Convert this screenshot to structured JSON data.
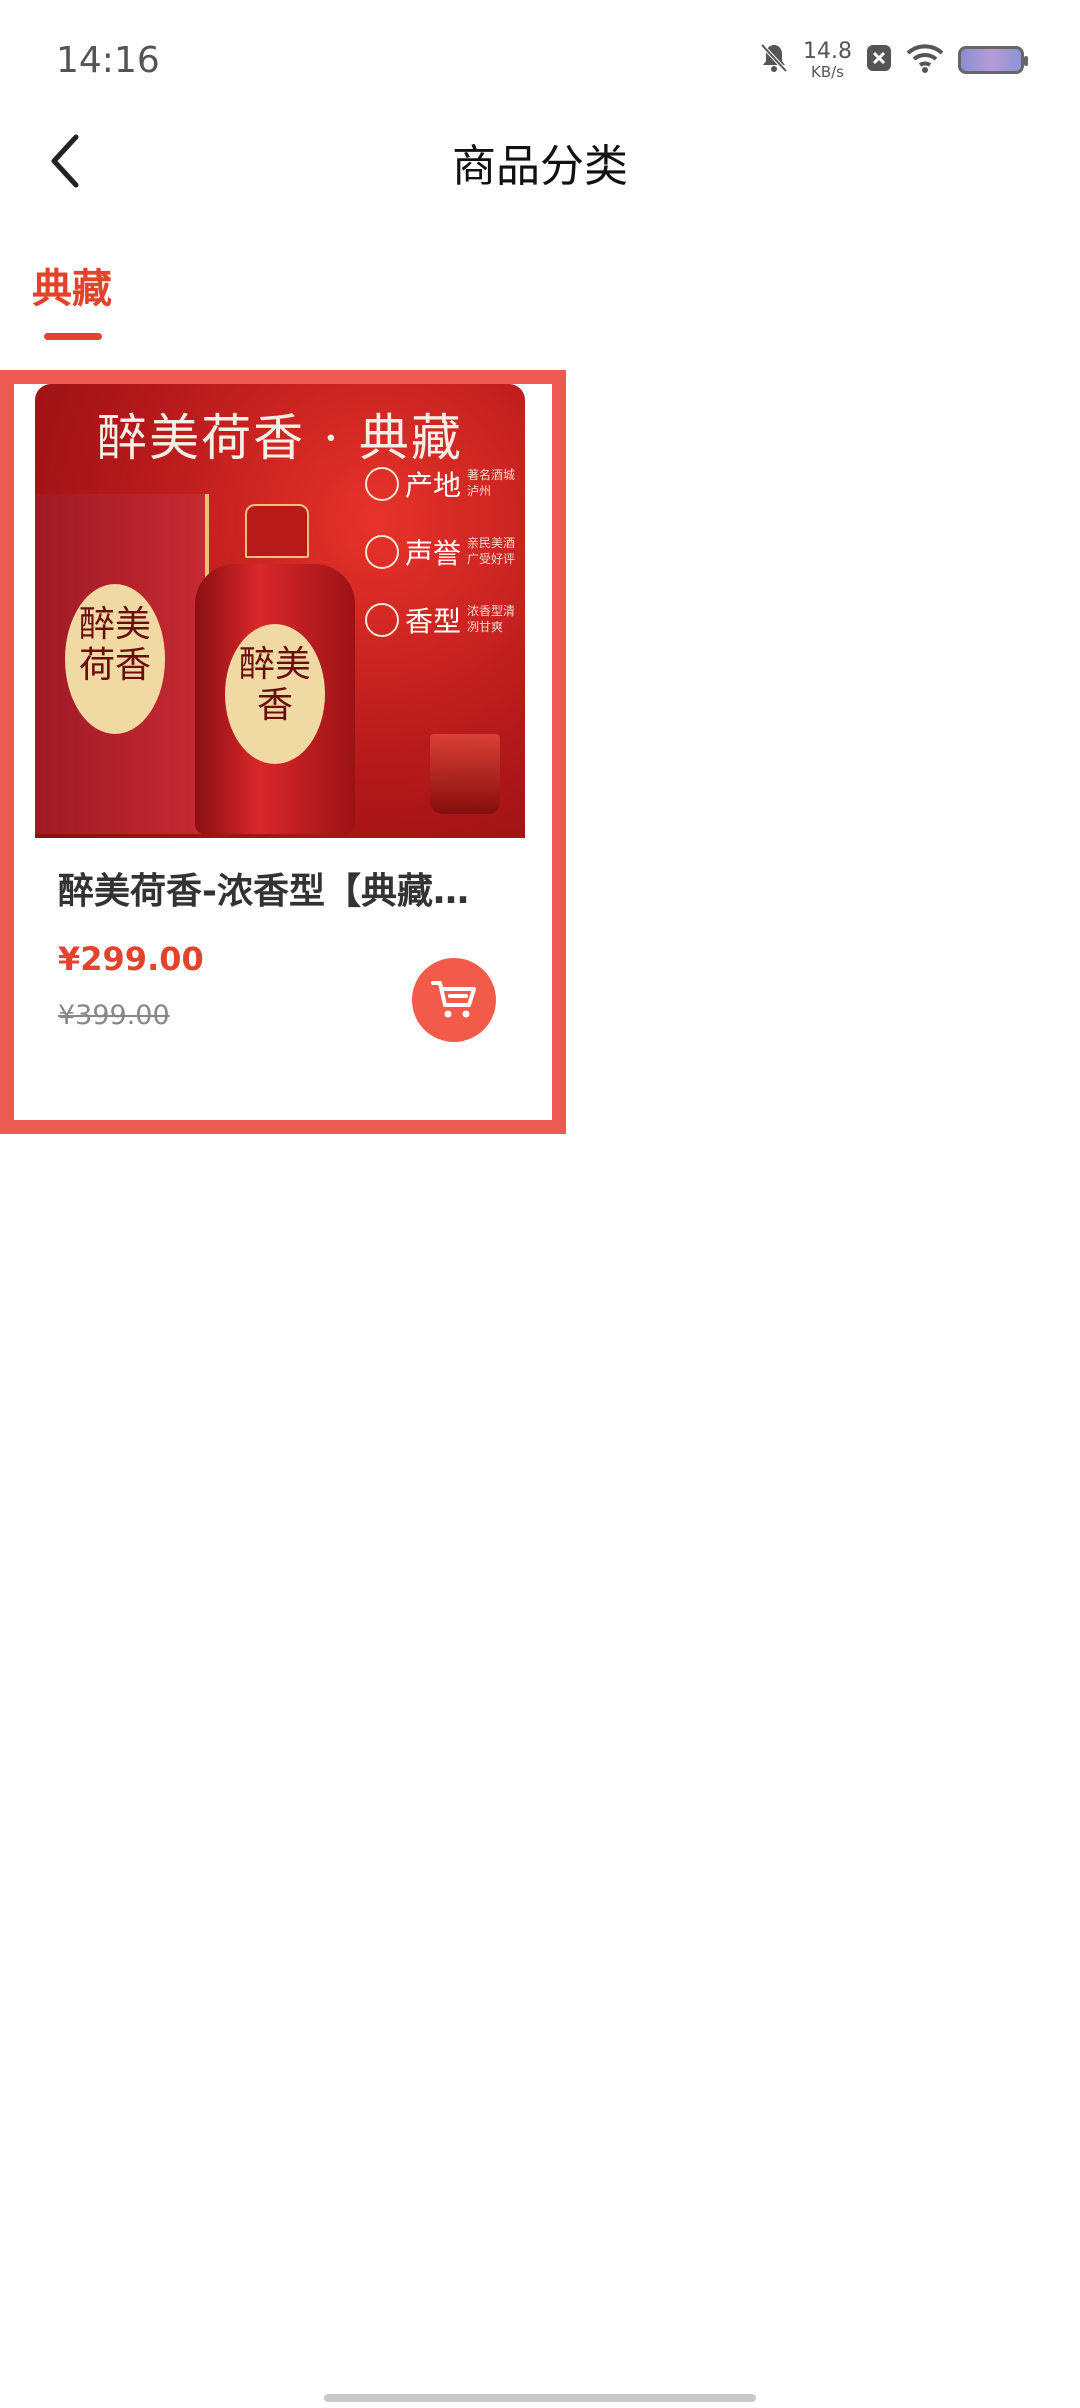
{
  "status_bar": {
    "time": "14:16",
    "net_speed_value": "14.8",
    "net_speed_unit": "KB/s",
    "icons": [
      "bell-muted-icon",
      "notification-x-icon",
      "wifi-icon",
      "battery-icon"
    ]
  },
  "header": {
    "title": "商品分类",
    "back_icon": "chevron-left-icon"
  },
  "tabs": [
    {
      "label": "典藏",
      "active": true
    }
  ],
  "products": [
    {
      "name": "醉美荷香-浓香型【典藏…",
      "price": "¥299.00",
      "original_price": "¥399.00",
      "cart_icon": "cart-icon",
      "image": {
        "headline": "醉美荷香 · 典藏",
        "box_label": "醉美荷香",
        "bottle_label": "醉美香",
        "features": [
          {
            "name": "产地",
            "desc": "著名酒城泸州"
          },
          {
            "name": "声誉",
            "desc": "亲民美酒广受好评"
          },
          {
            "name": "香型",
            "desc": "浓香型清冽甘爽"
          }
        ]
      }
    }
  ],
  "colors": {
    "accent": "#e2442b",
    "highlight_border": "#ee5a52",
    "cart_button": "#f25b4a"
  }
}
